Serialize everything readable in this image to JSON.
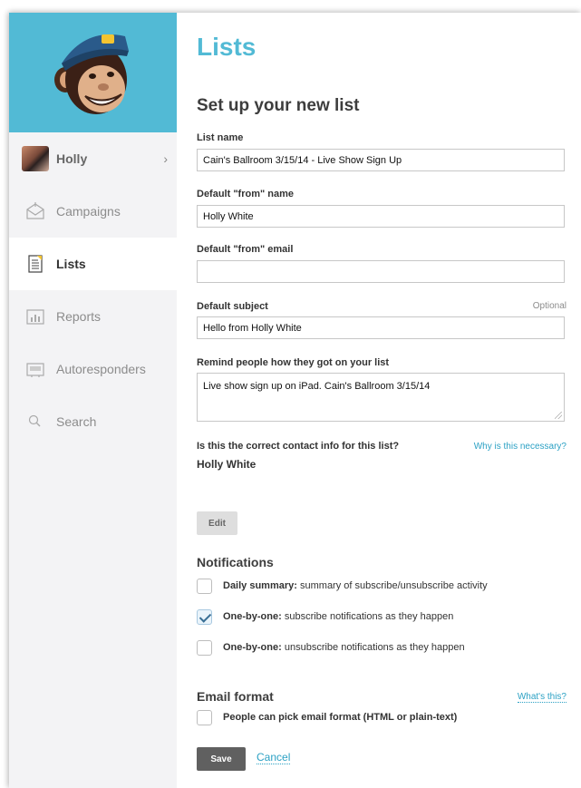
{
  "sidebar": {
    "user": {
      "name": "Holly"
    },
    "items": [
      {
        "label": "Campaigns"
      },
      {
        "label": "Lists"
      },
      {
        "label": "Reports"
      },
      {
        "label": "Autoresponders"
      },
      {
        "label": "Search"
      }
    ]
  },
  "main": {
    "title": "Lists",
    "section_title": "Set up your new list",
    "fields": {
      "list_name": {
        "label": "List name",
        "value": "Cain's Ballroom 3/15/14 - Live Show Sign Up"
      },
      "from_name": {
        "label": "Default \"from\" name",
        "value": "Holly White"
      },
      "from_email": {
        "label": "Default \"from\" email",
        "value": ""
      },
      "subject": {
        "label": "Default subject",
        "optional": "Optional",
        "value": "Hello from Holly White"
      },
      "remind": {
        "label": "Remind people how they got on your list",
        "value": "Live show sign up on iPad. Cain's Ballroom 3/15/14"
      }
    },
    "contact": {
      "question": "Is this the correct contact info for this list?",
      "why_link": "Why is this necessary?",
      "name": "Holly White",
      "edit_label": "Edit"
    },
    "notifications": {
      "title": "Notifications",
      "options": [
        {
          "bold": "Daily summary:",
          "text": "summary of subscribe/unsubscribe activity",
          "checked": false
        },
        {
          "bold": "One-by-one:",
          "text": "subscribe notifications as they happen",
          "checked": true
        },
        {
          "bold": "One-by-one:",
          "text": "unsubscribe notifications as they happen",
          "checked": false
        }
      ]
    },
    "email_format": {
      "title": "Email format",
      "whats_this": "What's this?",
      "option": "People can pick email format (HTML or plain-text)",
      "checked": false
    },
    "actions": {
      "save": "Save",
      "cancel": "Cancel"
    }
  },
  "colors": {
    "brand_blue": "#52bad5",
    "link_blue": "#2ca1c4",
    "save_button": "#606060"
  }
}
